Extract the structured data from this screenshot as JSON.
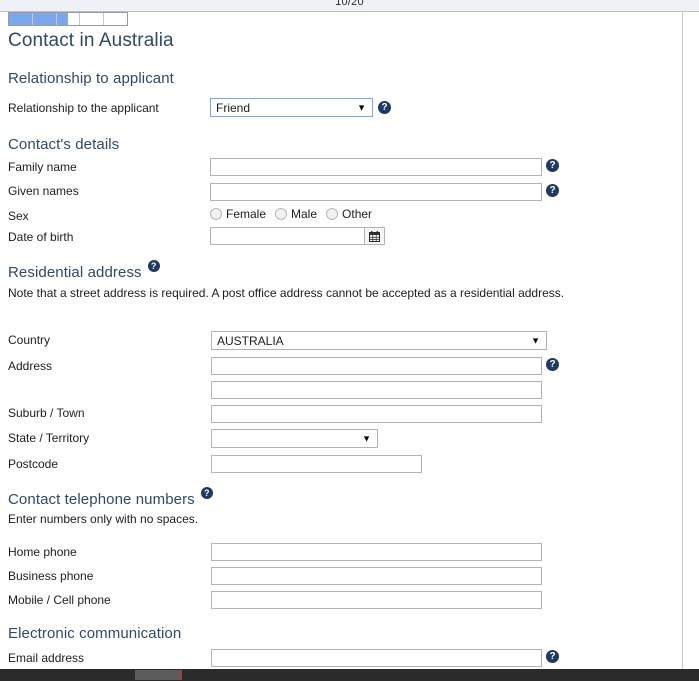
{
  "chrome": {
    "page_counter": "10/20"
  },
  "progress": {
    "percent": 50,
    "segments": 5
  },
  "page": {
    "title": "Contact in Australia"
  },
  "sections": {
    "relationship": {
      "heading": "Relationship to applicant",
      "fields": {
        "relationship_label": "Relationship to the applicant",
        "relationship_value": "Friend",
        "relationship_help": "?"
      }
    },
    "contact_details": {
      "heading": "Contact's details",
      "fields": {
        "family_name_label": "Family name",
        "family_name_value": "",
        "given_names_label": "Given names",
        "given_names_value": "",
        "sex_label": "Sex",
        "sex_options": [
          "Female",
          "Male",
          "Other"
        ],
        "dob_label": "Date of birth",
        "dob_value": ""
      }
    },
    "residential_address": {
      "heading": "Residential address",
      "note": "Note that a street address is required. A post office address cannot be accepted as a residential address.",
      "fields": {
        "country_label": "Country",
        "country_value": "AUSTRALIA",
        "address_label": "Address",
        "address_line1_value": "",
        "address_line2_value": "",
        "suburb_label": "Suburb / Town",
        "suburb_value": "",
        "state_label": "State / Territory",
        "state_value": "",
        "postcode_label": "Postcode",
        "postcode_value": ""
      }
    },
    "telephone": {
      "heading": "Contact telephone numbers",
      "note": "Enter numbers only with no spaces.",
      "fields": {
        "home_label": "Home phone",
        "home_value": "",
        "business_label": "Business phone",
        "business_value": "",
        "mobile_label": "Mobile / Cell phone",
        "mobile_value": ""
      }
    },
    "electronic": {
      "heading": "Electronic communication",
      "fields": {
        "email_label": "Email address",
        "email_value": ""
      }
    }
  },
  "icons": {
    "help": "?",
    "caret_down": "▼"
  },
  "colors": {
    "heading": "#2e4a66",
    "progress_fill": "#7ba7ec",
    "help_badge": "#1f3864",
    "field_border": "#b3b3b3",
    "focus_border": "#7ba7ec"
  }
}
